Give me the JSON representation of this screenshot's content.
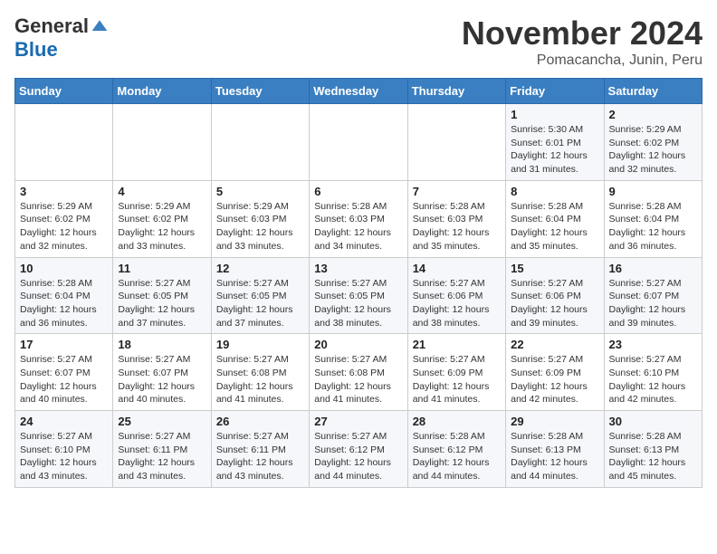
{
  "header": {
    "logo_general": "General",
    "logo_blue": "Blue",
    "month": "November 2024",
    "location": "Pomacancha, Junin, Peru"
  },
  "calendar": {
    "days_of_week": [
      "Sunday",
      "Monday",
      "Tuesday",
      "Wednesday",
      "Thursday",
      "Friday",
      "Saturday"
    ],
    "weeks": [
      [
        {
          "day": "",
          "info": ""
        },
        {
          "day": "",
          "info": ""
        },
        {
          "day": "",
          "info": ""
        },
        {
          "day": "",
          "info": ""
        },
        {
          "day": "",
          "info": ""
        },
        {
          "day": "1",
          "info": "Sunrise: 5:30 AM\nSunset: 6:01 PM\nDaylight: 12 hours and 31 minutes."
        },
        {
          "day": "2",
          "info": "Sunrise: 5:29 AM\nSunset: 6:02 PM\nDaylight: 12 hours and 32 minutes."
        }
      ],
      [
        {
          "day": "3",
          "info": "Sunrise: 5:29 AM\nSunset: 6:02 PM\nDaylight: 12 hours and 32 minutes."
        },
        {
          "day": "4",
          "info": "Sunrise: 5:29 AM\nSunset: 6:02 PM\nDaylight: 12 hours and 33 minutes."
        },
        {
          "day": "5",
          "info": "Sunrise: 5:29 AM\nSunset: 6:03 PM\nDaylight: 12 hours and 33 minutes."
        },
        {
          "day": "6",
          "info": "Sunrise: 5:28 AM\nSunset: 6:03 PM\nDaylight: 12 hours and 34 minutes."
        },
        {
          "day": "7",
          "info": "Sunrise: 5:28 AM\nSunset: 6:03 PM\nDaylight: 12 hours and 35 minutes."
        },
        {
          "day": "8",
          "info": "Sunrise: 5:28 AM\nSunset: 6:04 PM\nDaylight: 12 hours and 35 minutes."
        },
        {
          "day": "9",
          "info": "Sunrise: 5:28 AM\nSunset: 6:04 PM\nDaylight: 12 hours and 36 minutes."
        }
      ],
      [
        {
          "day": "10",
          "info": "Sunrise: 5:28 AM\nSunset: 6:04 PM\nDaylight: 12 hours and 36 minutes."
        },
        {
          "day": "11",
          "info": "Sunrise: 5:27 AM\nSunset: 6:05 PM\nDaylight: 12 hours and 37 minutes."
        },
        {
          "day": "12",
          "info": "Sunrise: 5:27 AM\nSunset: 6:05 PM\nDaylight: 12 hours and 37 minutes."
        },
        {
          "day": "13",
          "info": "Sunrise: 5:27 AM\nSunset: 6:05 PM\nDaylight: 12 hours and 38 minutes."
        },
        {
          "day": "14",
          "info": "Sunrise: 5:27 AM\nSunset: 6:06 PM\nDaylight: 12 hours and 38 minutes."
        },
        {
          "day": "15",
          "info": "Sunrise: 5:27 AM\nSunset: 6:06 PM\nDaylight: 12 hours and 39 minutes."
        },
        {
          "day": "16",
          "info": "Sunrise: 5:27 AM\nSunset: 6:07 PM\nDaylight: 12 hours and 39 minutes."
        }
      ],
      [
        {
          "day": "17",
          "info": "Sunrise: 5:27 AM\nSunset: 6:07 PM\nDaylight: 12 hours and 40 minutes."
        },
        {
          "day": "18",
          "info": "Sunrise: 5:27 AM\nSunset: 6:07 PM\nDaylight: 12 hours and 40 minutes."
        },
        {
          "day": "19",
          "info": "Sunrise: 5:27 AM\nSunset: 6:08 PM\nDaylight: 12 hours and 41 minutes."
        },
        {
          "day": "20",
          "info": "Sunrise: 5:27 AM\nSunset: 6:08 PM\nDaylight: 12 hours and 41 minutes."
        },
        {
          "day": "21",
          "info": "Sunrise: 5:27 AM\nSunset: 6:09 PM\nDaylight: 12 hours and 41 minutes."
        },
        {
          "day": "22",
          "info": "Sunrise: 5:27 AM\nSunset: 6:09 PM\nDaylight: 12 hours and 42 minutes."
        },
        {
          "day": "23",
          "info": "Sunrise: 5:27 AM\nSunset: 6:10 PM\nDaylight: 12 hours and 42 minutes."
        }
      ],
      [
        {
          "day": "24",
          "info": "Sunrise: 5:27 AM\nSunset: 6:10 PM\nDaylight: 12 hours and 43 minutes."
        },
        {
          "day": "25",
          "info": "Sunrise: 5:27 AM\nSunset: 6:11 PM\nDaylight: 12 hours and 43 minutes."
        },
        {
          "day": "26",
          "info": "Sunrise: 5:27 AM\nSunset: 6:11 PM\nDaylight: 12 hours and 43 minutes."
        },
        {
          "day": "27",
          "info": "Sunrise: 5:27 AM\nSunset: 6:12 PM\nDaylight: 12 hours and 44 minutes."
        },
        {
          "day": "28",
          "info": "Sunrise: 5:28 AM\nSunset: 6:12 PM\nDaylight: 12 hours and 44 minutes."
        },
        {
          "day": "29",
          "info": "Sunrise: 5:28 AM\nSunset: 6:13 PM\nDaylight: 12 hours and 44 minutes."
        },
        {
          "day": "30",
          "info": "Sunrise: 5:28 AM\nSunset: 6:13 PM\nDaylight: 12 hours and 45 minutes."
        }
      ]
    ]
  }
}
